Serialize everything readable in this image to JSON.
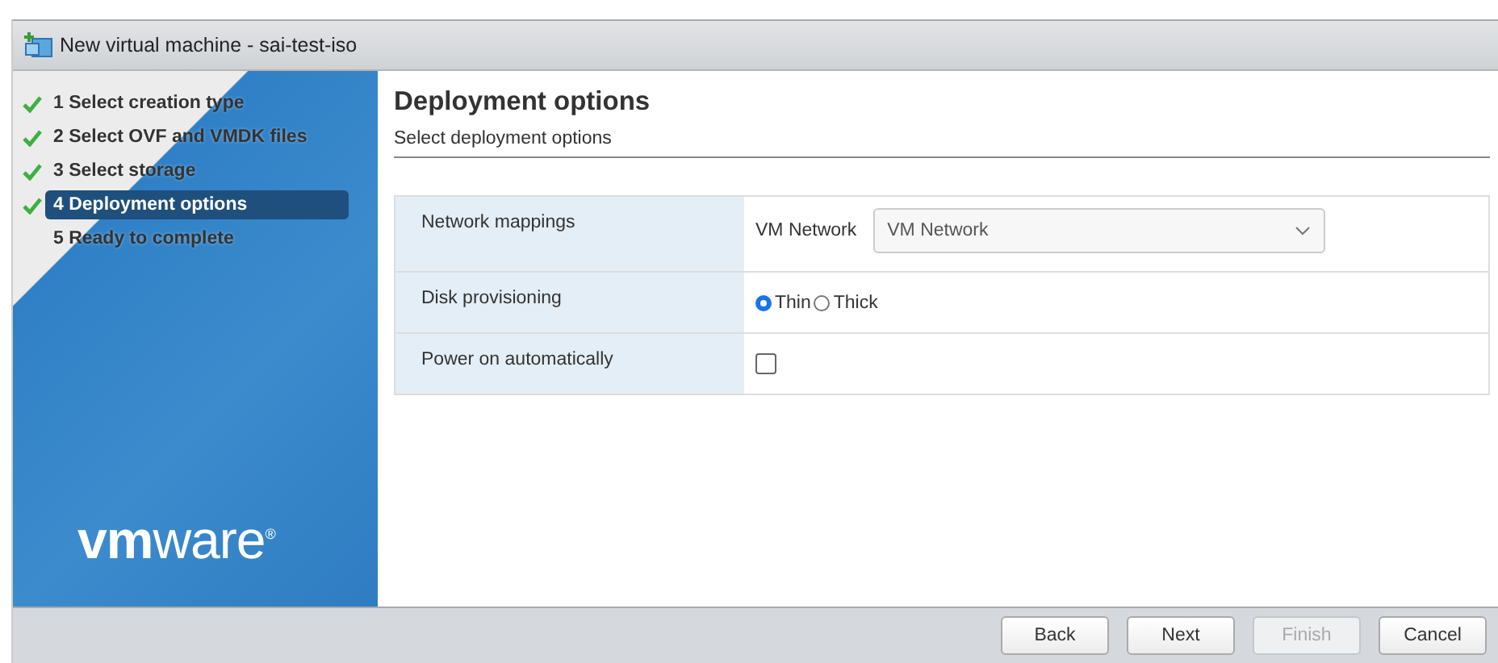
{
  "window": {
    "title": "New virtual machine - sai-test-iso"
  },
  "steps": [
    {
      "number": "1",
      "label": "Select creation type",
      "done": true,
      "selected": false
    },
    {
      "number": "2",
      "label": "Select OVF and VMDK files",
      "done": true,
      "selected": false
    },
    {
      "number": "3",
      "label": "Select storage",
      "done": true,
      "selected": false
    },
    {
      "number": "4",
      "label": "Deployment options",
      "done": true,
      "selected": true
    },
    {
      "number": "5",
      "label": "Ready to complete",
      "done": false,
      "selected": false
    }
  ],
  "logo": "**vm**ware$^{®}$",
  "page": {
    "title": "Deployment options",
    "subtitle": "Select deployment options"
  },
  "form": [
    {
      "kind": "select",
      "label": "Network mappings",
      "sublabel": "VM Network",
      "value": "VM Network"
    },
    {
      "kind": "radio",
      "label": "Disk provisioning",
      "options": [
        {
          "label": "Thin",
          "selected": true
        },
        {
          "label": "Thick",
          "selected": false
        }
      ]
    },
    {
      "kind": "checkbox",
      "label": "Power on automatically",
      "checked": false
    }
  ],
  "buttons": [
    {
      "label": "Back",
      "disabled": false
    },
    {
      "label": "Next",
      "disabled": false
    },
    {
      "label": "Finish",
      "disabled": true
    },
    {
      "label": "Cancel",
      "disabled": false
    }
  ]
}
